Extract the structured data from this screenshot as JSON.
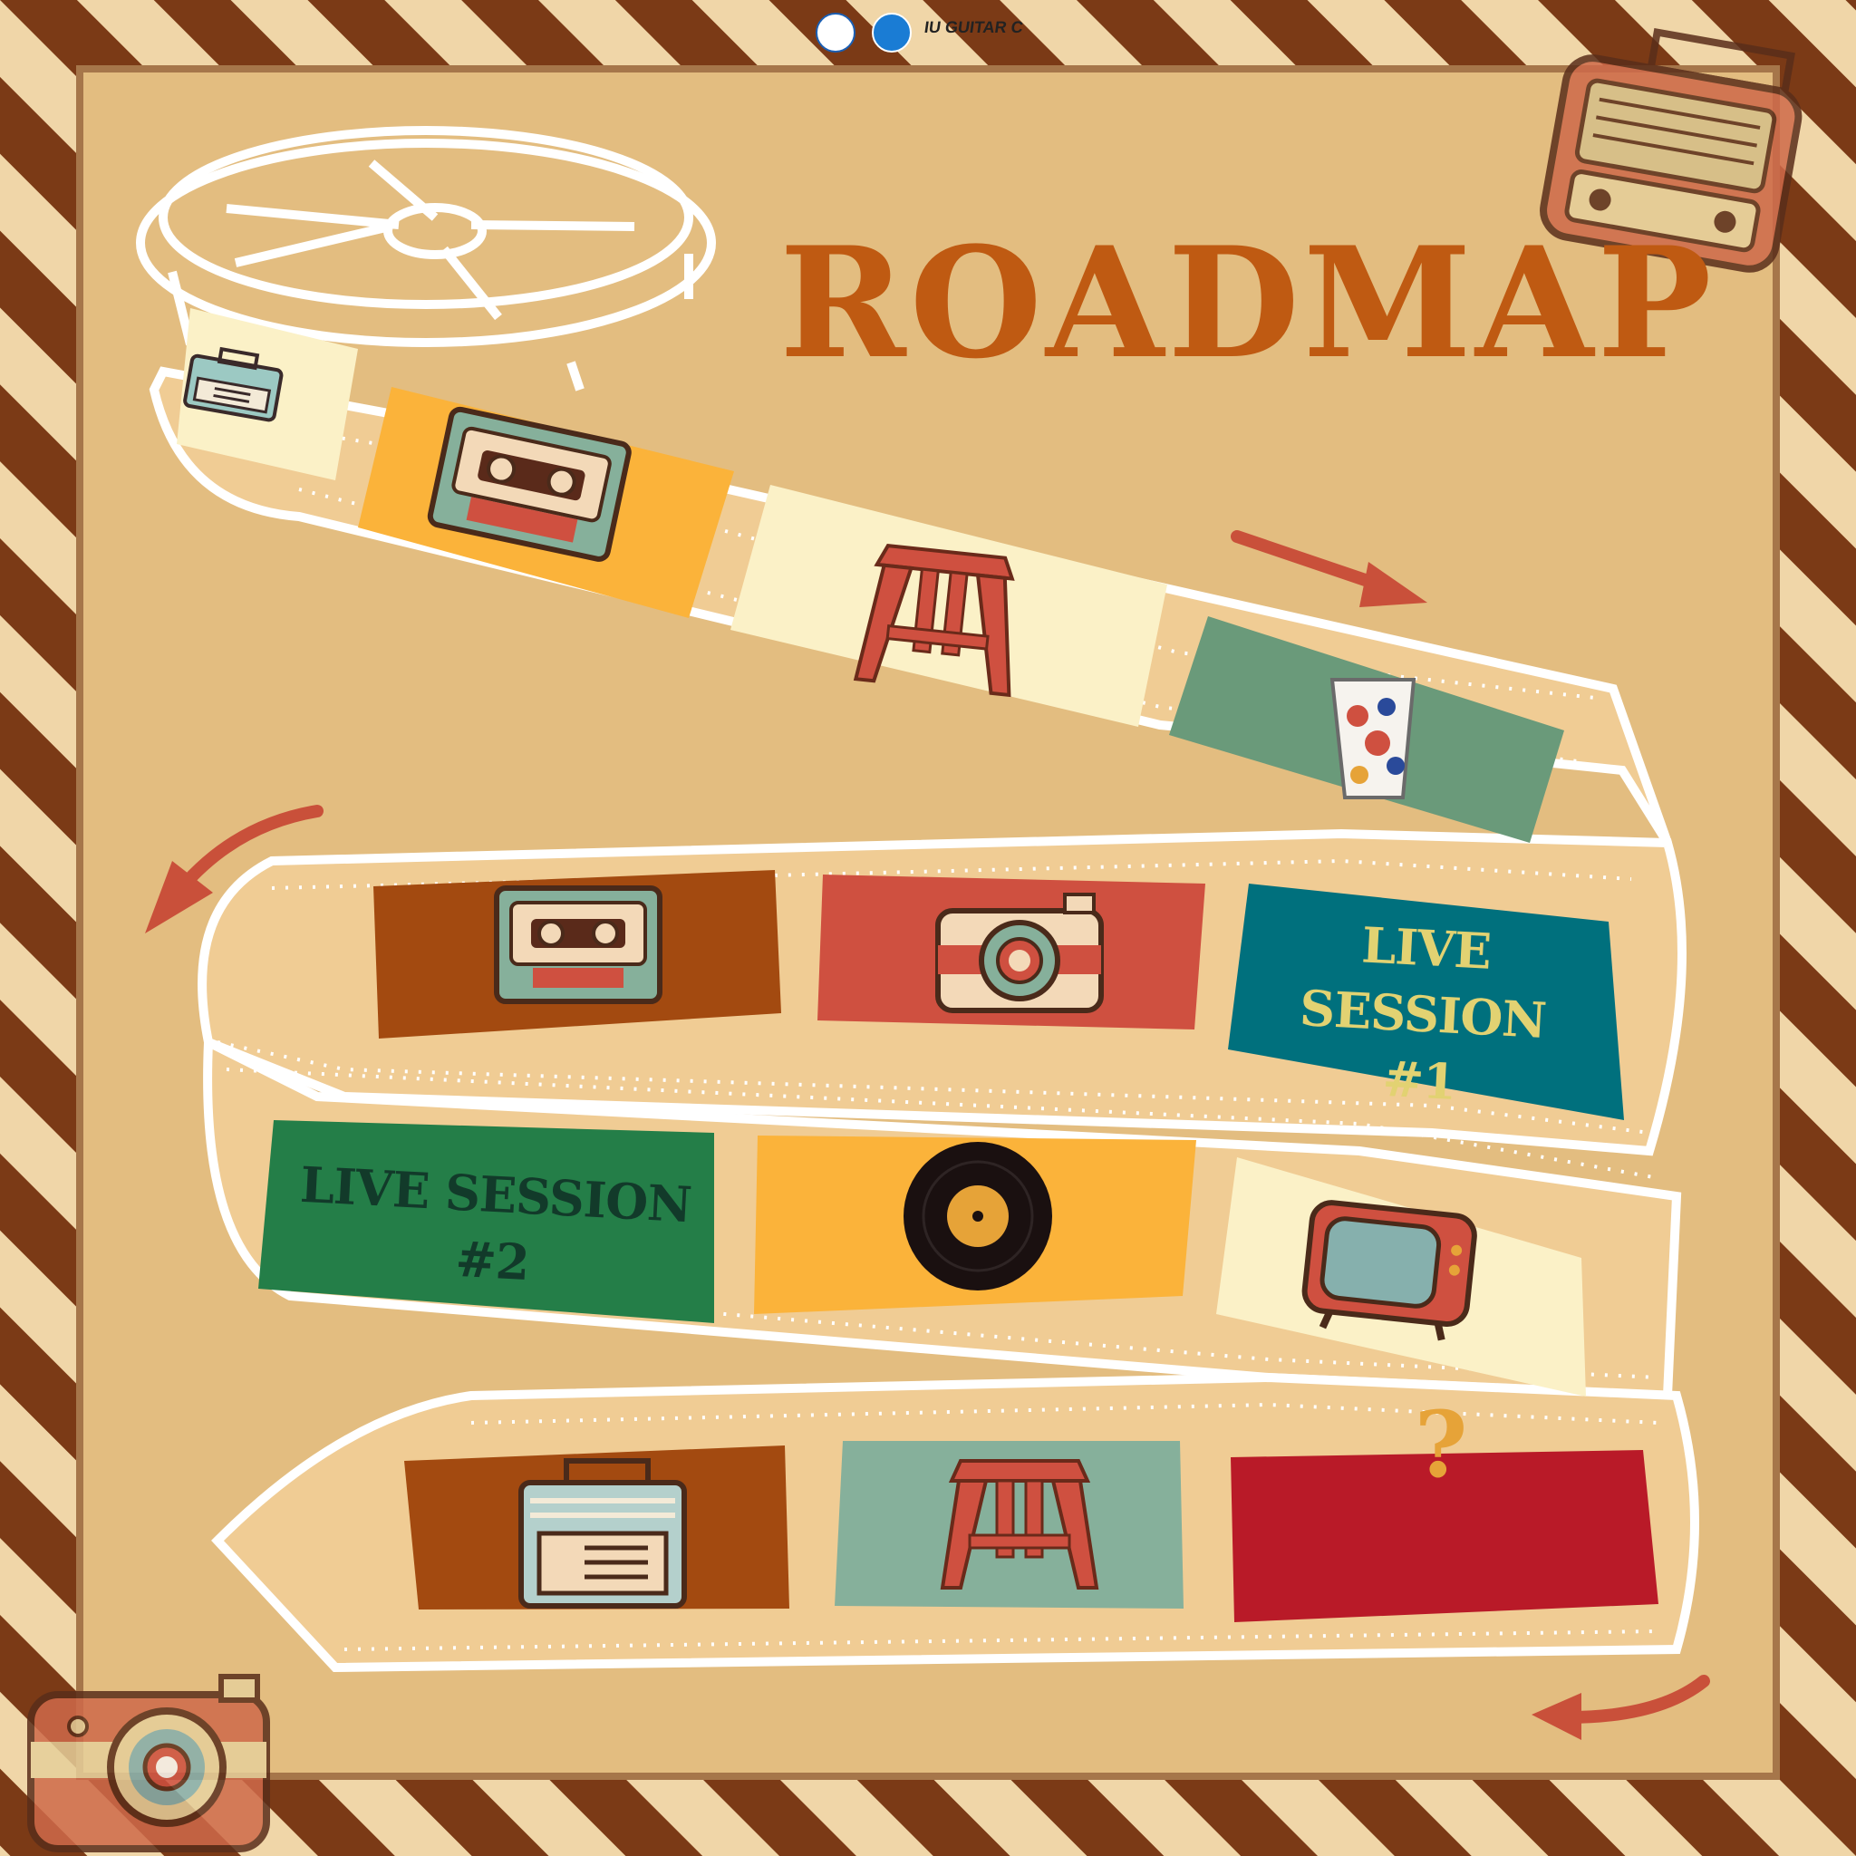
{
  "title": "ROADMAP",
  "sponsor": {
    "logo_text": "IU GUITAR C"
  },
  "sessions": {
    "live1": {
      "line1": "LIVE SESSION",
      "line2": "#1"
    },
    "live2": {
      "line1": "LIVE SESSION",
      "line2": "#2"
    },
    "final": "?"
  },
  "colors": {
    "background": "#e3bd80",
    "frame_stripe": "#7b3a16",
    "title": "#bf5a12",
    "film": "#ffffff",
    "arrow": "#c9503a"
  },
  "frames": [
    {
      "icon": "radio-icon",
      "color": "#fbf1c7"
    },
    {
      "icon": "cassette-icon",
      "color": "#fbb33a"
    },
    {
      "icon": "stool-icon",
      "color": "#fbf1c7"
    },
    {
      "icon": "glass-icon",
      "color": "#6a9a7a"
    },
    {
      "icon": "cassette-icon",
      "color": "#a34a10"
    },
    {
      "icon": "camera-icon",
      "color": "#cf5040"
    },
    {
      "icon": "live-session-1",
      "color": "#00707d"
    },
    {
      "icon": "live-session-2",
      "color": "#247e48"
    },
    {
      "icon": "vinyl-record-icon",
      "color": "#fbb33a"
    },
    {
      "icon": "tv-icon",
      "color": "#fbf1c7"
    },
    {
      "icon": "radio-icon",
      "color": "#a34a10"
    },
    {
      "icon": "stool-icon",
      "color": "#86b09b"
    },
    {
      "icon": "question-mark",
      "color": "#b91a28"
    }
  ]
}
